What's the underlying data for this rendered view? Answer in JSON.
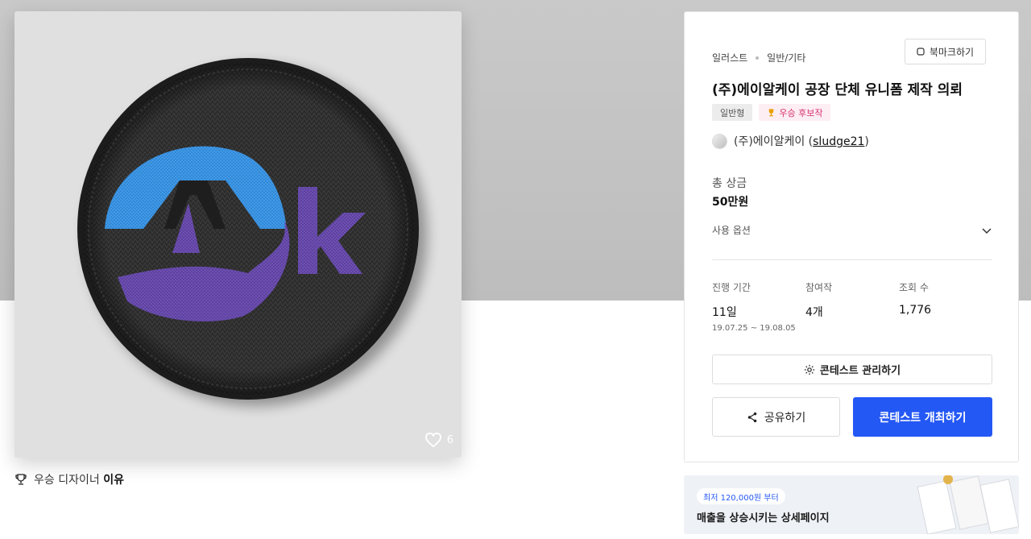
{
  "artwork": {
    "likes": "6",
    "logo_text": "Ark"
  },
  "winner_reason": {
    "label": "우승 디자이너",
    "strong": "이유"
  },
  "contest": {
    "category": "일러스트",
    "subcategory": "일반/기타",
    "bookmark_label": "북마크하기",
    "title": "(주)에이알케이 공장 단체 유니폼 제작 의뢰",
    "badges": [
      "일반형",
      "우승 후보작"
    ],
    "host_name": "(주)에이알케이",
    "host_id_open": "(",
    "host_id": "sludge21",
    "host_id_close": ")",
    "prize_label": "총 상금",
    "prize_value": "50만원",
    "options_label": "사용 옵션",
    "stats": {
      "period_label": "진행 기간",
      "period_value": "11일",
      "period_range": "19.07.25 ~ 19.08.05",
      "entries_label": "참여작",
      "entries_value": "4개",
      "views_label": "조회 수",
      "views_value": "1,776"
    },
    "manage_label": "콘테스트 관리하기",
    "share_label": "공유하기",
    "host_contest_label": "콘테스트 개최하기"
  },
  "ad": {
    "pill": "최저 120,000원 부터",
    "text": "매출을 상승시키는 상세페이지"
  },
  "colors": {
    "primary": "#2458f5",
    "badge_pink": "#d6336c",
    "logo_blue": "#2f86d6",
    "logo_purple": "#5b3f9c"
  }
}
